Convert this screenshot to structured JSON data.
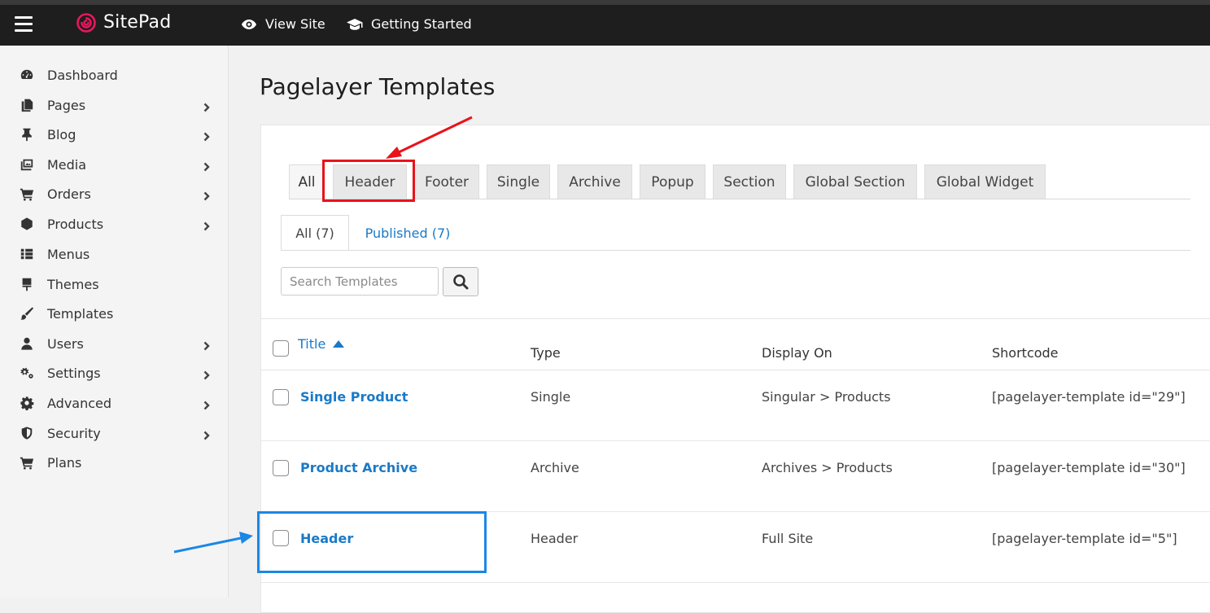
{
  "topbar": {
    "brand": "SitePad",
    "view_site": "View Site",
    "getting_started": "Getting Started"
  },
  "sidebar": {
    "items": [
      {
        "label": "Dashboard",
        "icon": "dashboard-icon",
        "has_children": false
      },
      {
        "label": "Pages",
        "icon": "pages-icon",
        "has_children": true
      },
      {
        "label": "Blog",
        "icon": "pin-icon",
        "has_children": true
      },
      {
        "label": "Media",
        "icon": "media-icon",
        "has_children": true
      },
      {
        "label": "Orders",
        "icon": "cart-icon",
        "has_children": true
      },
      {
        "label": "Products",
        "icon": "cube-icon",
        "has_children": true
      },
      {
        "label": "Menus",
        "icon": "list-icon",
        "has_children": false
      },
      {
        "label": "Themes",
        "icon": "brush-icon",
        "has_children": false
      },
      {
        "label": "Templates",
        "icon": "paintbrush-icon",
        "has_children": false
      },
      {
        "label": "Users",
        "icon": "user-icon",
        "has_children": true
      },
      {
        "label": "Settings",
        "icon": "gears-icon",
        "has_children": true
      },
      {
        "label": "Advanced",
        "icon": "gear-icon",
        "has_children": true
      },
      {
        "label": "Security",
        "icon": "shield-icon",
        "has_children": true
      },
      {
        "label": "Plans",
        "icon": "cart-icon",
        "has_children": false
      }
    ]
  },
  "main": {
    "title": "Pagelayer Templates",
    "type_tabs": [
      "All",
      "Header",
      "Footer",
      "Single",
      "Archive",
      "Popup",
      "Section",
      "Global Section",
      "Global Widget"
    ],
    "active_type_tab": "All",
    "status_tabs": {
      "all": "All (7)",
      "published": "Published (7)"
    },
    "search": {
      "placeholder": "Search Templates"
    },
    "table": {
      "columns": [
        "Title",
        "Type",
        "Display On",
        "Shortcode"
      ],
      "rows": [
        {
          "title": "Single Product",
          "type": "Single",
          "display_on": "Singular > Products",
          "shortcode": "[pagelayer-template id=\"29\"]"
        },
        {
          "title": "Product Archive",
          "type": "Archive",
          "display_on": "Archives > Products",
          "shortcode": "[pagelayer-template id=\"30\"]"
        },
        {
          "title": "Header",
          "type": "Header",
          "display_on": "Full Site",
          "shortcode": "[pagelayer-template id=\"5\"]"
        }
      ]
    }
  },
  "colors": {
    "topbar": "#1e1e1e",
    "brand_accent": "#e8175d",
    "link": "#1a7ac7",
    "highlight_red": "#e8131b",
    "highlight_blue": "#1b87e6"
  }
}
